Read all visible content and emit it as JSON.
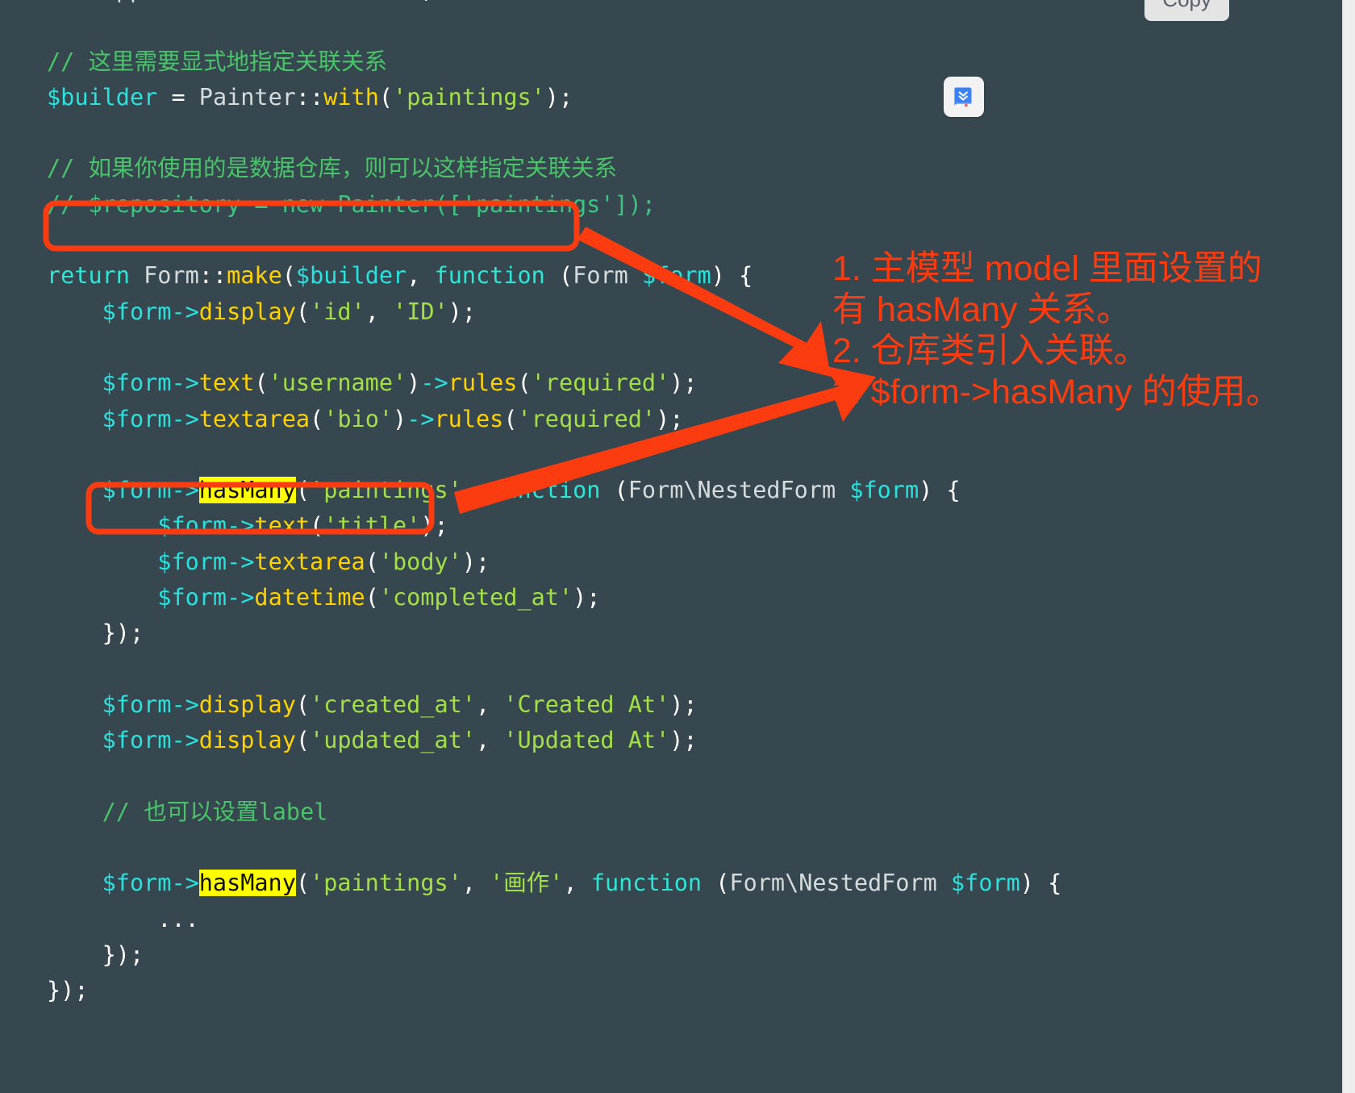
{
  "window": {
    "background_color": "#e9e9e9",
    "code_background_color": "#37474f",
    "accent_color": "#fa3c10",
    "highlight_color": "#ffff00"
  },
  "toolbar": {
    "copy_label": "Copy",
    "book_icon_name": "book-download-icon"
  },
  "code": {
    "language": "php",
    "lines": [
      "use App\\Models\\Demo\\Painter;",
      "",
      "// 这里需要显式地指定关联关系",
      "$builder = Painter::with('paintings');",
      "",
      "// 如果你使用的是数据仓库，则可以这样指定关联关系",
      "// $repository = new Painter(['paintings']);",
      "",
      "return Form::make($builder, function (Form $form) {",
      "    $form->display('id', 'ID');",
      "",
      "    $form->text('username')->rules('required');",
      "    $form->textarea('bio')->rules('required');",
      "",
      "    $form->hasMany('paintings', function (Form\\NestedForm $form) {",
      "        $form->text('title');",
      "        $form->textarea('body');",
      "        $form->datetime('completed_at');",
      "    });",
      "",
      "    $form->display('created_at', 'Created At');",
      "    $form->display('updated_at', 'Updated At');",
      "",
      "    // 也可以设置label",
      "",
      "    $form->hasMany('paintings', '画作', function (Form\\NestedForm $form) {",
      "        ...",
      "    });",
      "});"
    ],
    "highlighted_tokens": [
      "hasMany",
      "hasMany"
    ]
  },
  "annotations": {
    "notes": [
      "1. 主模型 model 里面设置的",
      "有 hasMany 关系。",
      "2. 仓库类引入关联。",
      "3. $form->hasMany 的使用。"
    ],
    "boxes": [
      {
        "name": "repository-line-box",
        "target": "// $repository = new Painter(['paintings']);"
      },
      {
        "name": "hasmany-line-box",
        "target": "$form->hasMany('paintings',"
      }
    ],
    "arrows": [
      {
        "name": "arrow-repository-to-note",
        "from": "repository-line-box",
        "to": "note-2"
      },
      {
        "name": "arrow-hasmany-to-note",
        "from": "hasmany-line-box",
        "to": "note-3"
      }
    ]
  }
}
